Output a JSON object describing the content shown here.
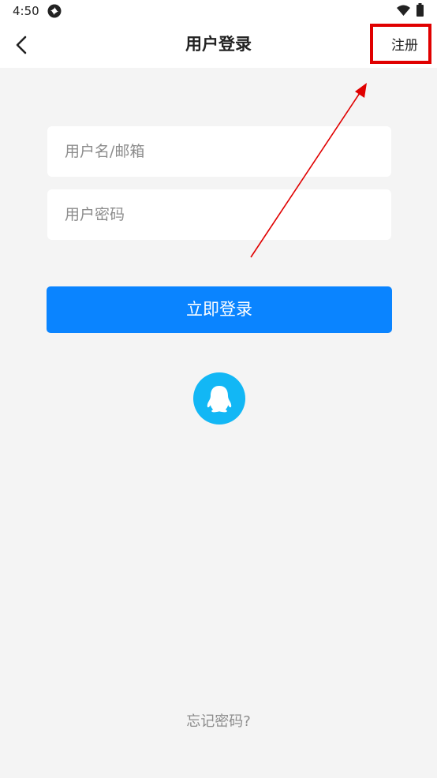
{
  "status_bar": {
    "time": "4:50",
    "icons": [
      "sync-icon",
      "wifi-icon",
      "battery-icon"
    ]
  },
  "header": {
    "back_icon": "chevron-left-icon",
    "title": "用户登录",
    "register_label": "注册"
  },
  "form": {
    "username_placeholder": "用户名/邮箱",
    "username_value": "",
    "password_placeholder": "用户密码",
    "password_value": "",
    "login_label": "立即登录"
  },
  "third_party": {
    "qq_icon": "qq-penguin-icon"
  },
  "forgot_password_label": "忘记密码?",
  "colors": {
    "primary": "#0a84ff",
    "qq": "#12b7f5",
    "annotation": "#e00000",
    "background": "#f4f4f4"
  }
}
